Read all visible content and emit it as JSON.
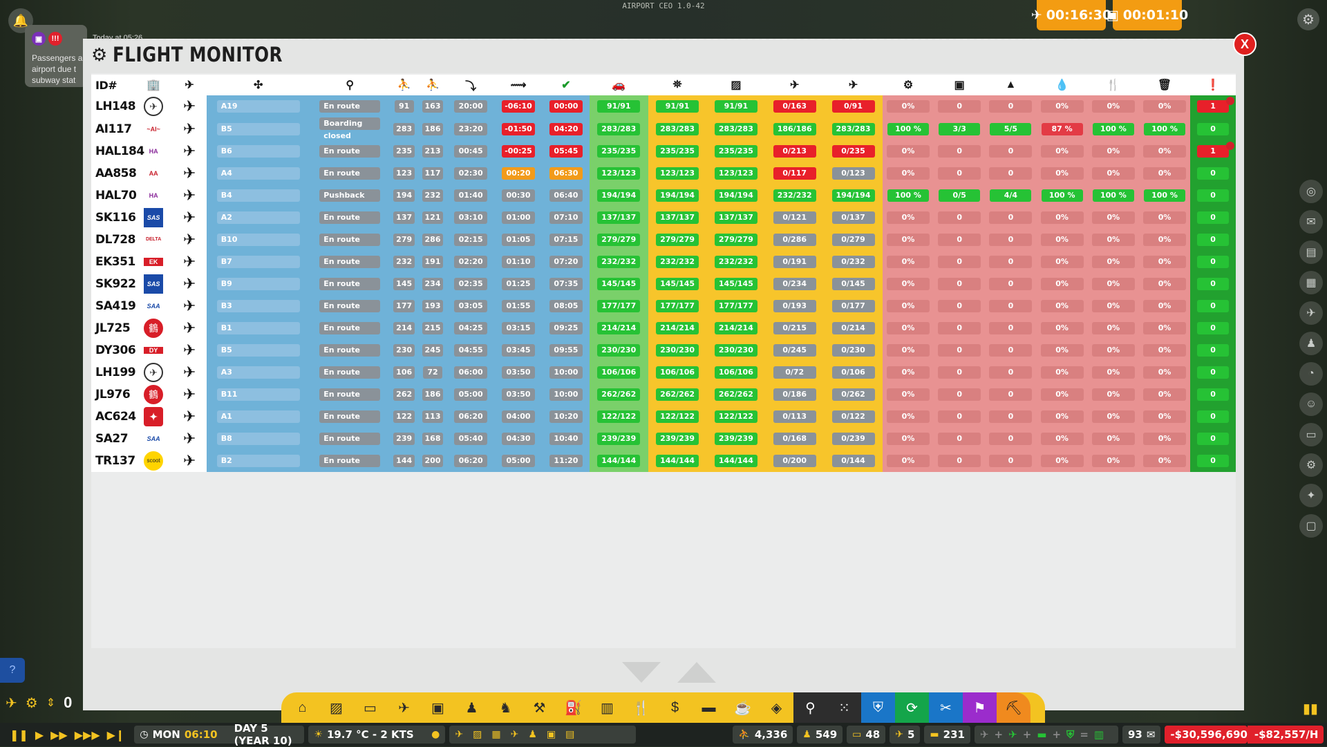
{
  "app": {
    "title": "AIRPORT CEO 1.0-42"
  },
  "timers": {
    "flight_timer": "00:16:30",
    "clock_timer": "00:01:10"
  },
  "notification": {
    "time": "Today at 05:26",
    "text": "Passengers a airport due t subway stat"
  },
  "window": {
    "title": "FLIGHT MONITOR",
    "close_label": "X"
  },
  "table": {
    "header_id": "ID#",
    "columns_icons": [
      "airline-icon",
      "aircraft-type-icon",
      "gate-icon",
      "status-icon",
      "pax-in-icon",
      "pax-out-icon",
      "arrival-time-icon",
      "departure-arrival-icon",
      "departure-time-icon",
      "vehicle-icon",
      "checked-in-icon",
      "security-icon",
      "boarded-icon",
      "deplaned-icon",
      "maintenance-icon",
      "baggage-icon",
      "cargo-icon",
      "fuel-icon",
      "catering-icon",
      "cleaning-icon",
      "alert-icon"
    ],
    "rows": [
      {
        "id": "LH148",
        "logo": "lufthansa",
        "gate": "A19",
        "status": "En route",
        "pax_in": "91",
        "pax_out": "163",
        "arr": "20:00",
        "delay": "-06:10",
        "delay_c": "red",
        "dep": "00:00",
        "dep_c": "red",
        "car": "91/91",
        "checkin": "91/91",
        "security": "91/91",
        "boarded": "0/163",
        "boarded_c": "red",
        "deplane": "0/91",
        "deplane_c": "red",
        "maint": "0%",
        "bag": "0",
        "cargo": "0",
        "fuel": "0%",
        "cater": "0%",
        "clean": "0%",
        "alert": "1",
        "alert_c": "red",
        "flag": true
      },
      {
        "id": "AI117",
        "logo": "airindia",
        "gate": "B5",
        "status": "Boarding closed",
        "pax_in": "283",
        "pax_out": "186",
        "arr": "23:20",
        "delay": "-01:50",
        "delay_c": "red",
        "dep": "04:20",
        "dep_c": "red",
        "car": "283/283",
        "checkin": "283/283",
        "security": "283/283",
        "boarded": "186/186",
        "boarded_c": "green",
        "deplane": "283/283",
        "deplane_c": "green",
        "maint": "100 %",
        "bag": "3/3",
        "cargo": "5/5",
        "fuel": "87 %",
        "cater": "100 %",
        "clean": "100 %",
        "alert": "0",
        "alert_c": "green",
        "svc": true,
        "fuel_red": true
      },
      {
        "id": "HAL184",
        "logo": "hawaiian",
        "gate": "B6",
        "status": "En route",
        "pax_in": "235",
        "pax_out": "213",
        "arr": "00:45",
        "delay": "-00:25",
        "delay_c": "red",
        "dep": "05:45",
        "dep_c": "red",
        "car": "235/235",
        "checkin": "235/235",
        "security": "235/235",
        "boarded": "0/213",
        "boarded_c": "red",
        "deplane": "0/235",
        "deplane_c": "red",
        "maint": "0%",
        "bag": "0",
        "cargo": "0",
        "fuel": "0%",
        "cater": "0%",
        "clean": "0%",
        "alert": "1",
        "alert_c": "red",
        "flag": true
      },
      {
        "id": "AA858",
        "logo": "american",
        "gate": "A4",
        "status": "En route",
        "pax_in": "123",
        "pax_out": "117",
        "arr": "02:30",
        "delay": "00:20",
        "delay_c": "orange",
        "dep": "06:30",
        "dep_c": "orange",
        "car": "123/123",
        "checkin": "123/123",
        "security": "123/123",
        "boarded": "0/117",
        "boarded_c": "red",
        "deplane": "0/123",
        "deplane_c": "gray",
        "maint": "0%",
        "bag": "0",
        "cargo": "0",
        "fuel": "0%",
        "cater": "0%",
        "clean": "0%",
        "alert": "0",
        "alert_c": "green"
      },
      {
        "id": "HAL70",
        "logo": "hawaiian",
        "gate": "B4",
        "status": "Pushback",
        "pax_in": "194",
        "pax_out": "232",
        "arr": "01:40",
        "delay": "00:30",
        "delay_c": "gray",
        "dep": "06:40",
        "dep_c": "gray",
        "car": "194/194",
        "checkin": "194/194",
        "security": "194/194",
        "boarded": "232/232",
        "boarded_c": "green",
        "deplane": "194/194",
        "deplane_c": "green",
        "maint": "100 %",
        "bag": "0/5",
        "cargo": "4/4",
        "fuel": "100 %",
        "cater": "100 %",
        "clean": "100 %",
        "alert": "0",
        "alert_c": "green",
        "svc": true
      },
      {
        "id": "SK116",
        "logo": "sas",
        "gate": "A2",
        "status": "En route",
        "pax_in": "137",
        "pax_out": "121",
        "arr": "03:10",
        "delay": "01:00",
        "delay_c": "gray",
        "dep": "07:10",
        "dep_c": "gray",
        "car": "137/137",
        "checkin": "137/137",
        "security": "137/137",
        "boarded": "0/121",
        "boarded_c": "gray",
        "deplane": "0/137",
        "deplane_c": "gray",
        "maint": "0%",
        "bag": "0",
        "cargo": "0",
        "fuel": "0%",
        "cater": "0%",
        "clean": "0%",
        "alert": "0",
        "alert_c": "green"
      },
      {
        "id": "DL728",
        "logo": "delta",
        "gate": "B10",
        "status": "En route",
        "pax_in": "279",
        "pax_out": "286",
        "arr": "02:15",
        "delay": "01:05",
        "delay_c": "gray",
        "dep": "07:15",
        "dep_c": "gray",
        "car": "279/279",
        "checkin": "279/279",
        "security": "279/279",
        "boarded": "0/286",
        "boarded_c": "gray",
        "deplane": "0/279",
        "deplane_c": "gray",
        "maint": "0%",
        "bag": "0",
        "cargo": "0",
        "fuel": "0%",
        "cater": "0%",
        "clean": "0%",
        "alert": "0",
        "alert_c": "green"
      },
      {
        "id": "EK351",
        "logo": "emirates",
        "gate": "B7",
        "status": "En route",
        "pax_in": "232",
        "pax_out": "191",
        "arr": "02:20",
        "delay": "01:10",
        "delay_c": "gray",
        "dep": "07:20",
        "dep_c": "gray",
        "car": "232/232",
        "checkin": "232/232",
        "security": "232/232",
        "boarded": "0/191",
        "boarded_c": "gray",
        "deplane": "0/232",
        "deplane_c": "gray",
        "maint": "0%",
        "bag": "0",
        "cargo": "0",
        "fuel": "0%",
        "cater": "0%",
        "clean": "0%",
        "alert": "0",
        "alert_c": "green"
      },
      {
        "id": "SK922",
        "logo": "sas",
        "gate": "B9",
        "status": "En route",
        "pax_in": "145",
        "pax_out": "234",
        "arr": "02:35",
        "delay": "01:25",
        "delay_c": "gray",
        "dep": "07:35",
        "dep_c": "gray",
        "car": "145/145",
        "checkin": "145/145",
        "security": "145/145",
        "boarded": "0/234",
        "boarded_c": "gray",
        "deplane": "0/145",
        "deplane_c": "gray",
        "maint": "0%",
        "bag": "0",
        "cargo": "0",
        "fuel": "0%",
        "cater": "0%",
        "clean": "0%",
        "alert": "0",
        "alert_c": "green"
      },
      {
        "id": "SA419",
        "logo": "saa",
        "gate": "B3",
        "status": "En route",
        "pax_in": "177",
        "pax_out": "193",
        "arr": "03:05",
        "delay": "01:55",
        "delay_c": "gray",
        "dep": "08:05",
        "dep_c": "gray",
        "car": "177/177",
        "checkin": "177/177",
        "security": "177/177",
        "boarded": "0/193",
        "boarded_c": "gray",
        "deplane": "0/177",
        "deplane_c": "gray",
        "maint": "0%",
        "bag": "0",
        "cargo": "0",
        "fuel": "0%",
        "cater": "0%",
        "clean": "0%",
        "alert": "0",
        "alert_c": "green"
      },
      {
        "id": "JL725",
        "logo": "jal",
        "gate": "B1",
        "status": "En route",
        "pax_in": "214",
        "pax_out": "215",
        "arr": "04:25",
        "delay": "03:15",
        "delay_c": "gray",
        "dep": "09:25",
        "dep_c": "gray",
        "car": "214/214",
        "checkin": "214/214",
        "security": "214/214",
        "boarded": "0/215",
        "boarded_c": "gray",
        "deplane": "0/214",
        "deplane_c": "gray",
        "maint": "0%",
        "bag": "0",
        "cargo": "0",
        "fuel": "0%",
        "cater": "0%",
        "clean": "0%",
        "alert": "0",
        "alert_c": "green"
      },
      {
        "id": "DY306",
        "logo": "norwegian",
        "gate": "B5",
        "status": "En route",
        "pax_in": "230",
        "pax_out": "245",
        "arr": "04:55",
        "delay": "03:45",
        "delay_c": "gray",
        "dep": "09:55",
        "dep_c": "gray",
        "car": "230/230",
        "checkin": "230/230",
        "security": "230/230",
        "boarded": "0/245",
        "boarded_c": "gray",
        "deplane": "0/230",
        "deplane_c": "gray",
        "maint": "0%",
        "bag": "0",
        "cargo": "0",
        "fuel": "0%",
        "cater": "0%",
        "clean": "0%",
        "alert": "0",
        "alert_c": "green"
      },
      {
        "id": "LH199",
        "logo": "lufthansa",
        "gate": "A3",
        "status": "En route",
        "pax_in": "106",
        "pax_out": "72",
        "arr": "06:00",
        "delay": "03:50",
        "delay_c": "gray",
        "dep": "10:00",
        "dep_c": "gray",
        "car": "106/106",
        "checkin": "106/106",
        "security": "106/106",
        "boarded": "0/72",
        "boarded_c": "gray",
        "deplane": "0/106",
        "deplane_c": "gray",
        "maint": "0%",
        "bag": "0",
        "cargo": "0",
        "fuel": "0%",
        "cater": "0%",
        "clean": "0%",
        "alert": "0",
        "alert_c": "green"
      },
      {
        "id": "JL976",
        "logo": "jal",
        "gate": "B11",
        "status": "En route",
        "pax_in": "262",
        "pax_out": "186",
        "arr": "05:00",
        "delay": "03:50",
        "delay_c": "gray",
        "dep": "10:00",
        "dep_c": "gray",
        "car": "262/262",
        "checkin": "262/262",
        "security": "262/262",
        "boarded": "0/186",
        "boarded_c": "gray",
        "deplane": "0/262",
        "deplane_c": "gray",
        "maint": "0%",
        "bag": "0",
        "cargo": "0",
        "fuel": "0%",
        "cater": "0%",
        "clean": "0%",
        "alert": "0",
        "alert_c": "green"
      },
      {
        "id": "AC624",
        "logo": "aircanada",
        "gate": "A1",
        "status": "En route",
        "pax_in": "122",
        "pax_out": "113",
        "arr": "06:20",
        "delay": "04:00",
        "delay_c": "gray",
        "dep": "10:20",
        "dep_c": "gray",
        "car": "122/122",
        "checkin": "122/122",
        "security": "122/122",
        "boarded": "0/113",
        "boarded_c": "gray",
        "deplane": "0/122",
        "deplane_c": "gray",
        "maint": "0%",
        "bag": "0",
        "cargo": "0",
        "fuel": "0%",
        "cater": "0%",
        "clean": "0%",
        "alert": "0",
        "alert_c": "green"
      },
      {
        "id": "SA27",
        "logo": "saa",
        "gate": "B8",
        "status": "En route",
        "pax_in": "239",
        "pax_out": "168",
        "arr": "05:40",
        "delay": "04:30",
        "delay_c": "gray",
        "dep": "10:40",
        "dep_c": "gray",
        "car": "239/239",
        "checkin": "239/239",
        "security": "239/239",
        "boarded": "0/168",
        "boarded_c": "gray",
        "deplane": "0/239",
        "deplane_c": "gray",
        "maint": "0%",
        "bag": "0",
        "cargo": "0",
        "fuel": "0%",
        "cater": "0%",
        "clean": "0%",
        "alert": "0",
        "alert_c": "green"
      },
      {
        "id": "TR137",
        "logo": "scoot",
        "gate": "B2",
        "status": "En route",
        "pax_in": "144",
        "pax_out": "200",
        "arr": "06:20",
        "delay": "05:00",
        "delay_c": "gray",
        "dep": "11:20",
        "dep_c": "gray",
        "car": "144/144",
        "checkin": "144/144",
        "security": "144/144",
        "boarded": "0/200",
        "boarded_c": "gray",
        "deplane": "0/144",
        "deplane_c": "gray",
        "maint": "0%",
        "bag": "0",
        "cargo": "0",
        "fuel": "0%",
        "cater": "0%",
        "clean": "0%",
        "alert": "0",
        "alert_c": "green"
      }
    ]
  },
  "toolbar": {
    "icons": [
      "terminal-icon",
      "runway-icon",
      "vehicle-icon",
      "aircraft-icon",
      "baggage-icon",
      "staff-icon",
      "security-staff-icon",
      "cleaning-icon",
      "fuel-icon",
      "infrastructure-icon",
      "food-icon",
      "finance-icon",
      "bus-icon",
      "dining-icon",
      "cargo-icon",
      "search-icon",
      "grid-icon",
      "security-shield-icon",
      "refresh-icon",
      "ats-icon",
      "manage-icon",
      "excavator-icon"
    ]
  },
  "speed_value": "0",
  "status": {
    "day": "MON",
    "time": "06:10",
    "day_label": "DAY 5 (YEAR 10)",
    "weather": "19.7 °C - 2 KTS",
    "passengers": "4,336",
    "staff": "549",
    "vehicles_count": "48",
    "flights": "5",
    "cars": "231",
    "mail_count": "93",
    "money": "-$30,596,690",
    "rate": "-$82,557/H"
  }
}
